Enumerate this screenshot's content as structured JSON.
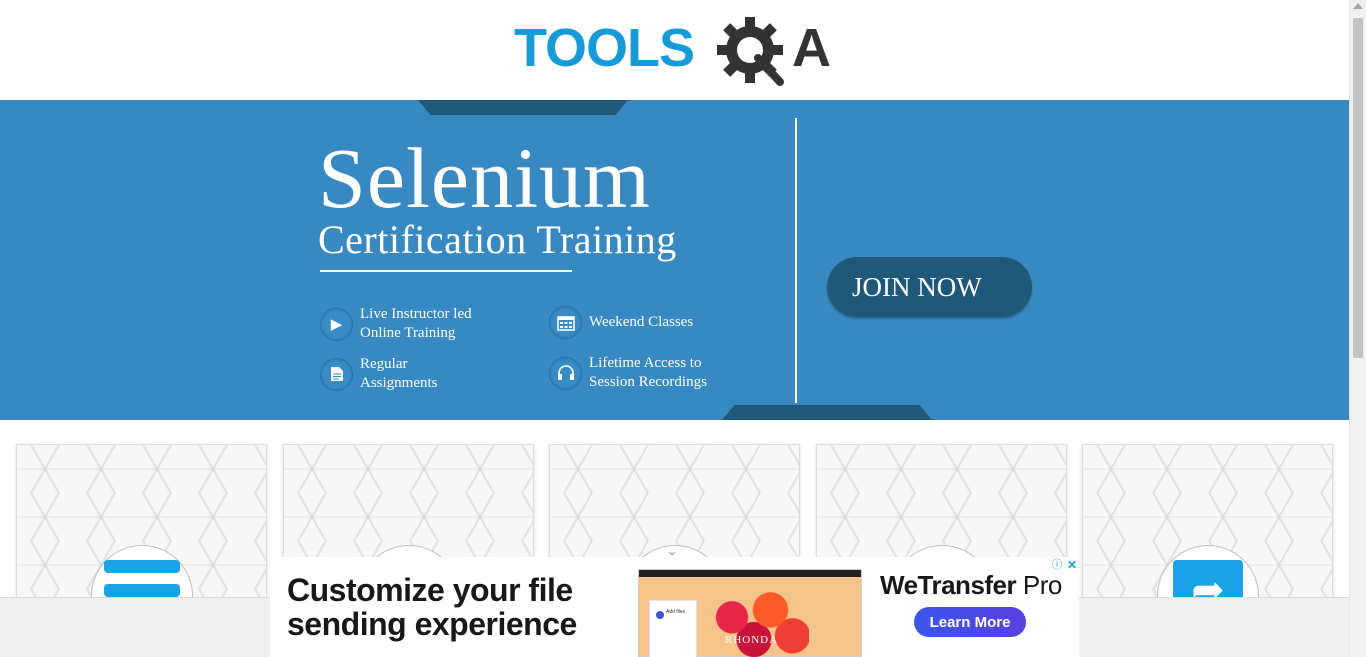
{
  "logo": {
    "text": "TOOLSQA",
    "tools": "TOOLS",
    "q": "Q",
    "a": "A",
    "tools_color": "#179bd7",
    "qa_color": "#333333",
    "icon": "gear-magnifier-icon"
  },
  "banner": {
    "title": "Selenium",
    "subtitle": "Certification Training",
    "features": [
      {
        "line1": "Live Instructor led",
        "line2": "Online Training",
        "icon": "play-icon"
      },
      {
        "line1": "Weekend Classes",
        "line2": "",
        "icon": "calendar-icon"
      },
      {
        "line1": "Regular",
        "line2": "Assignments",
        "icon": "document-icon"
      },
      {
        "line1": "Lifetime Access to",
        "line2": "Session Recordings",
        "icon": "headphones-icon"
      }
    ],
    "cta": "JOIN NOW",
    "bg_color": "#3889c2",
    "accent_color": "#1f5878"
  },
  "cards": [
    {
      "icon": "menu-lines-icon"
    },
    {
      "icon": "card-icon"
    },
    {
      "icon": "chevron-down-icon"
    },
    {
      "icon": "card-icon"
    },
    {
      "icon": "share-icon"
    }
  ],
  "ad": {
    "headline1": "Customize your file",
    "headline2": "sending experience",
    "brand_bold": "WeTransfer",
    "brand_light": " Pro",
    "cta": "Learn More",
    "preview_name": "RHONDA",
    "preview_panel": "Add files",
    "info_icon": "info-icon",
    "close_icon": "close-icon",
    "cta_color": "#3a56ea"
  }
}
